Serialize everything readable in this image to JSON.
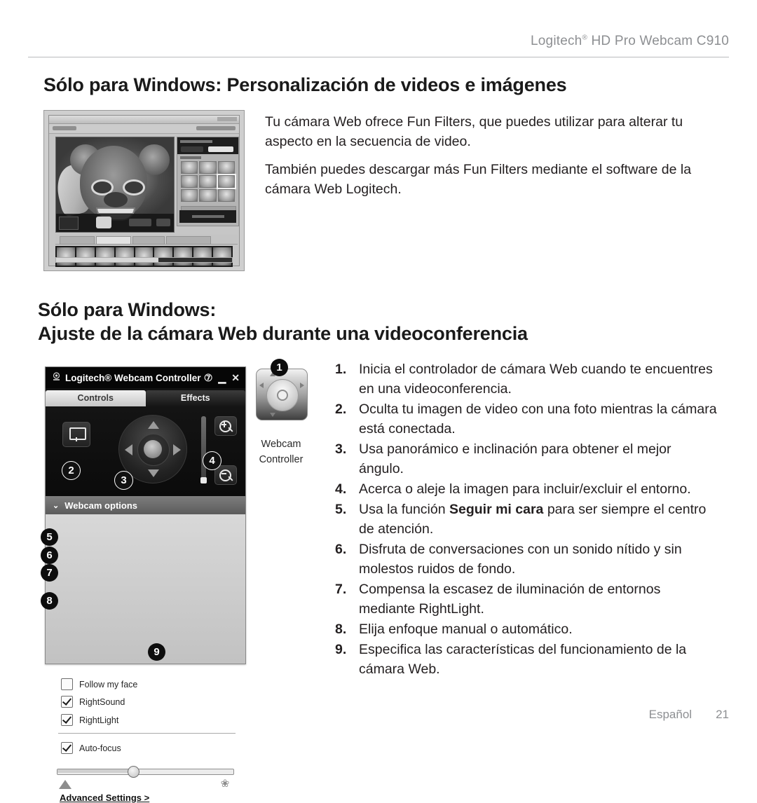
{
  "header": {
    "product": "Logitech",
    "product_mark": "®",
    "product_rest": " HD Pro Webcam C910"
  },
  "section_one": {
    "heading": "Sólo para Windows: Personalización de videos e imágenes",
    "paragraphs": [
      "Tu cámara Web ofrece Fun Filters, que puedes utilizar para alterar tu aspecto en la secuencia de video.",
      "También puedes descargar más Fun Filters mediante el software de la cámara Web Logitech."
    ]
  },
  "section_two": {
    "heading_line1": "Sólo para Windows:",
    "heading_line2": "Ajuste de la cámara Web durante una videoconferencia",
    "steps": [
      {
        "num": "1.",
        "text": "Inicia el controlador de cámara Web cuando te encuentres en una videoconferencia."
      },
      {
        "num": "2.",
        "text": "Oculta tu imagen de video con una foto mientras la cámara está conectada."
      },
      {
        "num": "3.",
        "text": "Usa panorámico e inclinación para obtener el mejor ángulo."
      },
      {
        "num": "4.",
        "text": "Acerca o aleje la imagen para incluir/excluir el entorno."
      },
      {
        "num": "5.",
        "text_before": "Usa la función ",
        "bold": "Seguir mi cara",
        "text_after": " para ser siempre el centro de atención."
      },
      {
        "num": "6.",
        "text": "Disfruta de conversaciones con un sonido nítido y sin molestos ruidos de fondo."
      },
      {
        "num": "7.",
        "text": "Compensa la escasez de iluminación de entornos mediante RightLight."
      },
      {
        "num": "8.",
        "text": "Elija enfoque manual o automático."
      },
      {
        "num": "9.",
        "text": "Especifica las características del funcionamiento de la cámara Web."
      }
    ]
  },
  "webcam_controller": {
    "title": "Logitech® Webcam Controller",
    "window_buttons": {
      "help": "⑦",
      "minimize": "▁",
      "close": "✕"
    },
    "tabs": [
      {
        "label": "Controls",
        "active": true
      },
      {
        "label": "Effects",
        "active": false
      }
    ],
    "options_section": {
      "chevron": "⌄",
      "title": "Webcam options",
      "checkboxes": [
        {
          "label": "Follow my face",
          "checked": false
        },
        {
          "label": "RightSound",
          "checked": true
        },
        {
          "label": "RightLight",
          "checked": true
        },
        {
          "label": "Auto-focus",
          "checked": true
        }
      ]
    },
    "focus_slider": {
      "value_percent": "40"
    },
    "advanced_link": "Advanced Settings >"
  },
  "desktop_icon": {
    "label_line1": "Webcam",
    "label_line2": "Controller"
  },
  "callouts": {
    "c1": "1",
    "c2": "2",
    "c3": "3",
    "c4": "4",
    "c5": "5",
    "c6": "6",
    "c7": "7",
    "c8": "8",
    "c9": "9"
  },
  "footer": {
    "language": "Español",
    "page": "21"
  },
  "colors": {
    "page_bg": "#ffffff",
    "text": "#231f20",
    "header_gray": "#8d8f92",
    "rule": "#b9bbbd",
    "callout_bg": "#0d0d0d"
  }
}
